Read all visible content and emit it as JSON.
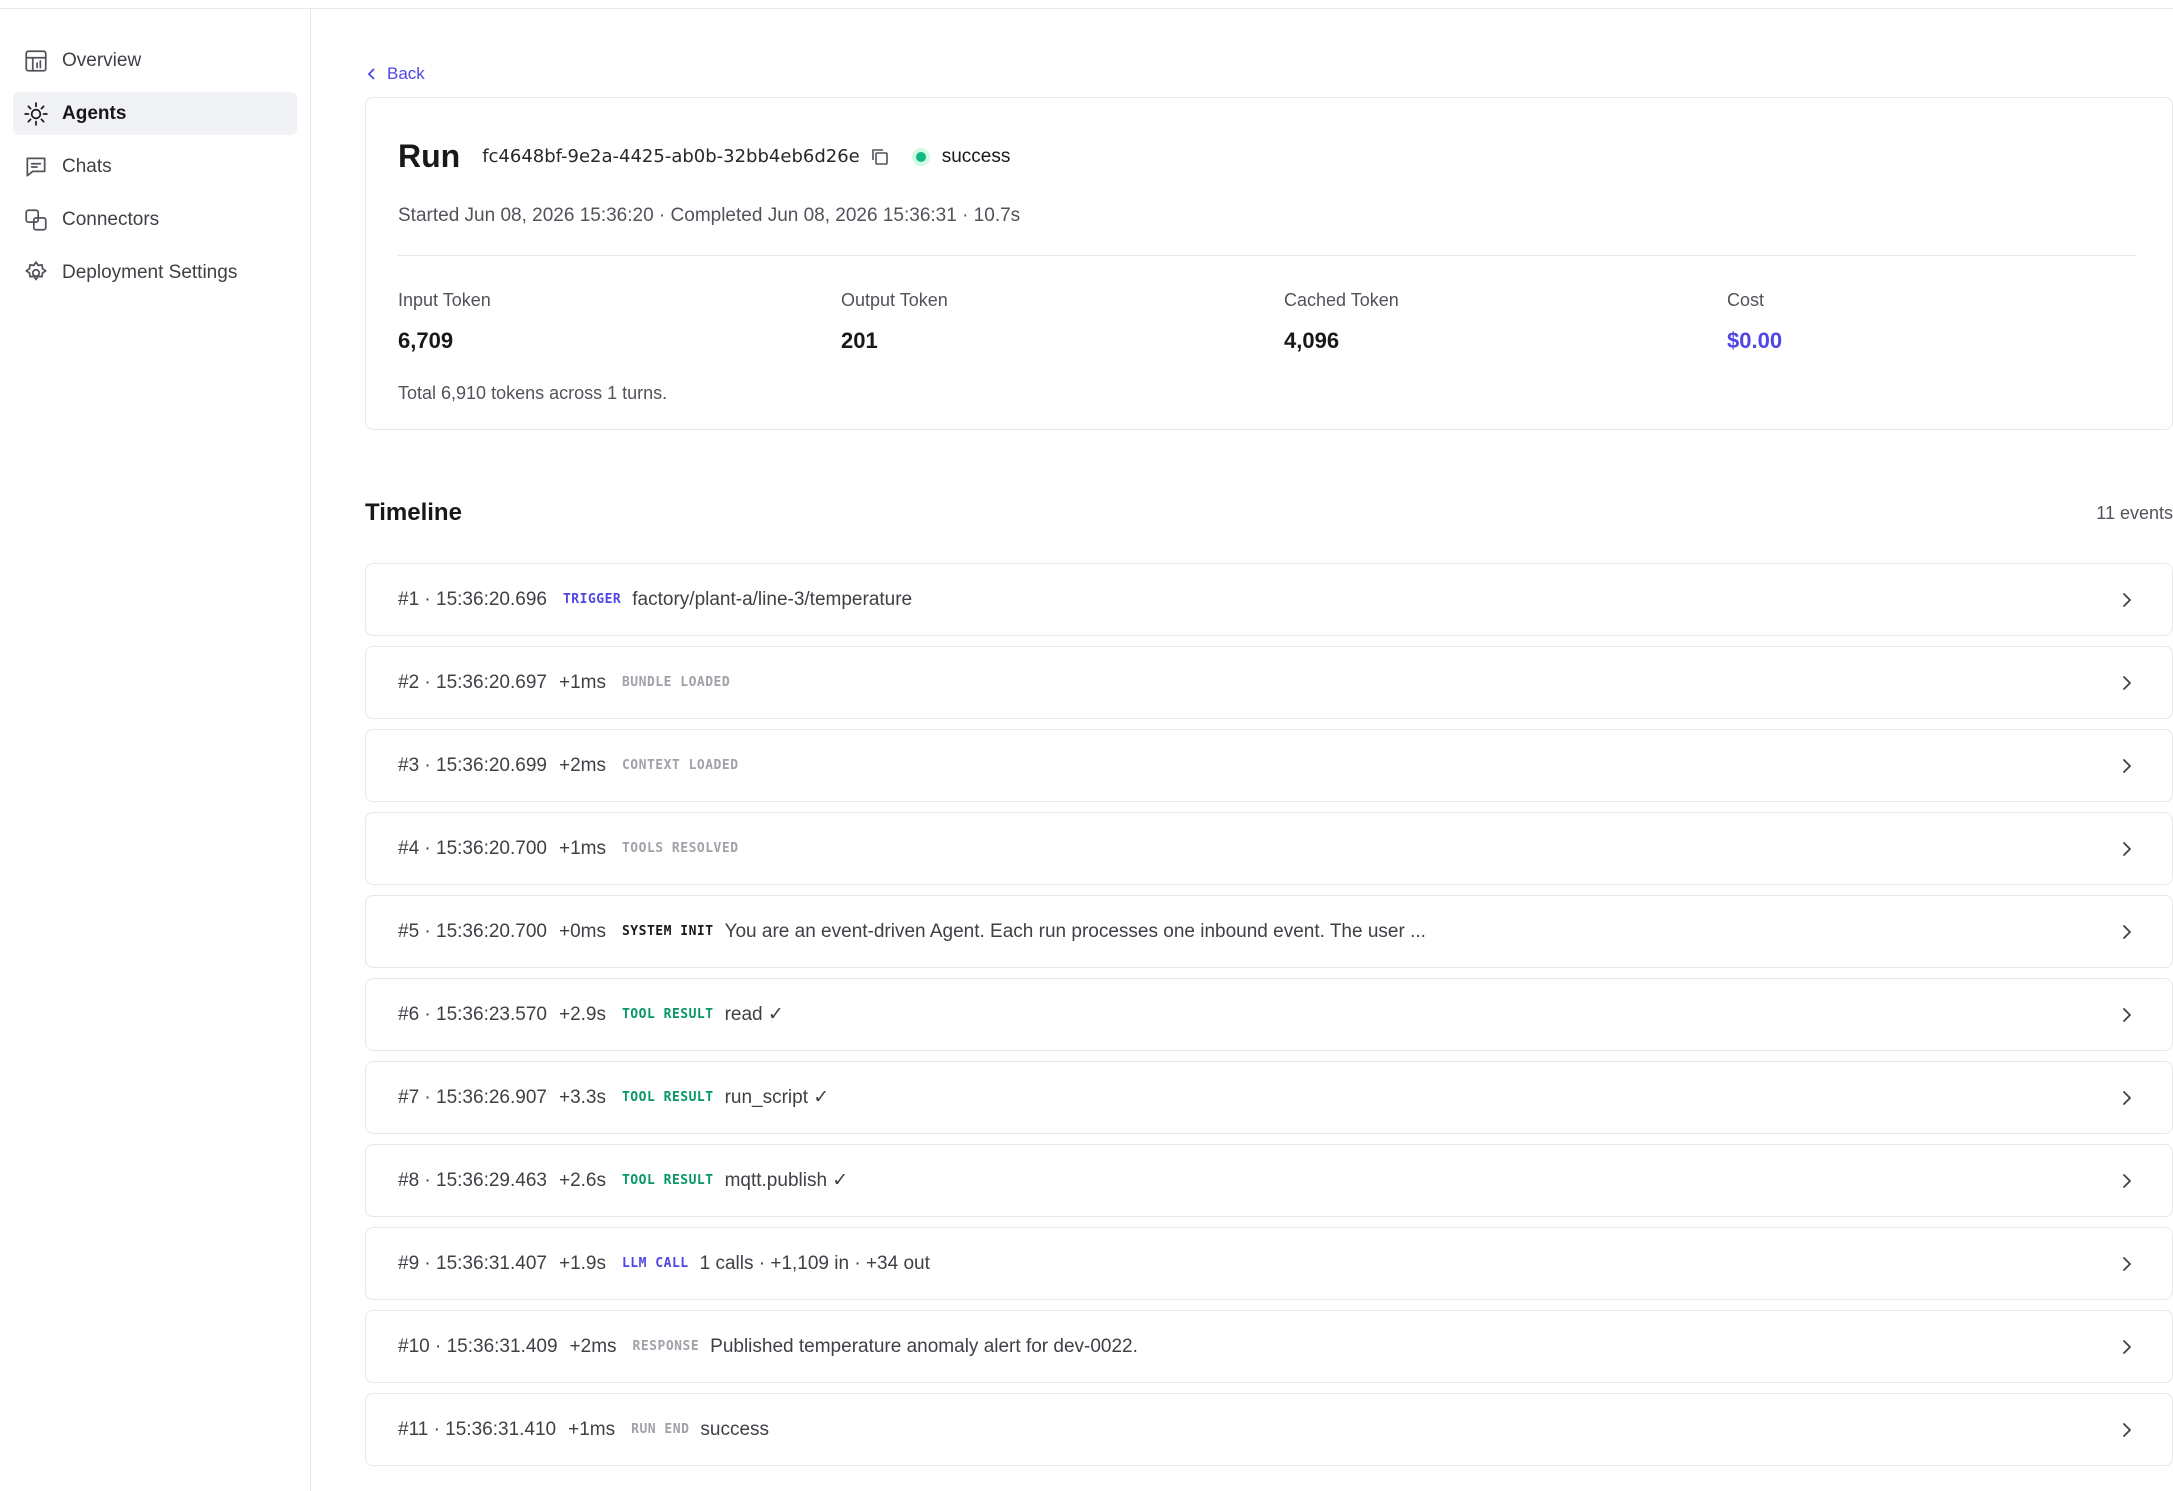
{
  "sidebar": {
    "items": [
      {
        "label": "Overview",
        "icon": "overview-icon"
      },
      {
        "label": "Agents",
        "icon": "agents-icon",
        "active": true
      },
      {
        "label": "Chats",
        "icon": "chat-icon"
      },
      {
        "label": "Connectors",
        "icon": "connectors-icon"
      },
      {
        "label": "Deployment Settings",
        "icon": "gear-icon"
      }
    ]
  },
  "back_label": "Back",
  "run": {
    "title": "Run",
    "id": "fc4648bf-9e2a-4425-ab0b-32bb4eb6d26e",
    "status": "success",
    "status_color": "#10b981",
    "meta": "Started Jun 08, 2026 15:36:20 · Completed Jun 08, 2026 15:36:31 · 10.7s",
    "stats": {
      "input": {
        "label": "Input Token",
        "value": "6,709"
      },
      "output": {
        "label": "Output Token",
        "value": "201"
      },
      "cached": {
        "label": "Cached Token",
        "value": "4,096"
      },
      "cost": {
        "label": "Cost",
        "value": "$0.00"
      }
    },
    "tokens_total": "Total 6,910 tokens across 1 turns."
  },
  "timeline": {
    "title": "Timeline",
    "count": "11 events",
    "events": [
      {
        "head": "#1 · 15:36:20.696",
        "delta": "",
        "tag": "TRIGGER",
        "tag_style": "trigger",
        "text": "factory/plant-a/line-3/temperature"
      },
      {
        "head": "#2 · 15:36:20.697",
        "delta": "+1ms",
        "tag": "BUNDLE LOADED",
        "tag_style": "muted",
        "text": ""
      },
      {
        "head": "#3 · 15:36:20.699",
        "delta": "+2ms",
        "tag": "CONTEXT LOADED",
        "tag_style": "muted",
        "text": ""
      },
      {
        "head": "#4 · 15:36:20.700",
        "delta": "+1ms",
        "tag": "TOOLS RESOLVED",
        "tag_style": "muted",
        "text": ""
      },
      {
        "head": "#5 · 15:36:20.700",
        "delta": "+0ms",
        "tag": "SYSTEM INIT",
        "tag_style": "dark",
        "text": "You are an event-driven Agent. Each run processes one inbound event. The user ..."
      },
      {
        "head": "#6 · 15:36:23.570",
        "delta": "+2.9s",
        "tag": "TOOL RESULT",
        "tag_style": "green",
        "text": "read ✓"
      },
      {
        "head": "#7 · 15:36:26.907",
        "delta": "+3.3s",
        "tag": "TOOL RESULT",
        "tag_style": "green",
        "text": "run_script ✓"
      },
      {
        "head": "#8 · 15:36:29.463",
        "delta": "+2.6s",
        "tag": "TOOL RESULT",
        "tag_style": "green",
        "text": "mqtt.publish ✓"
      },
      {
        "head": "#9 · 15:36:31.407",
        "delta": "+1.9s",
        "tag": "LLM CALL",
        "tag_style": "blue",
        "text": "1 calls · +1,109 in · +34 out"
      },
      {
        "head": "#10 · 15:36:31.409",
        "delta": "+2ms",
        "tag": "RESPONSE",
        "tag_style": "muted",
        "text": "Published temperature anomaly alert for dev-0022."
      },
      {
        "head": "#11 · 15:36:31.410",
        "delta": "+1ms",
        "tag": "RUN END",
        "tag_style": "muted",
        "text": "success"
      }
    ]
  }
}
